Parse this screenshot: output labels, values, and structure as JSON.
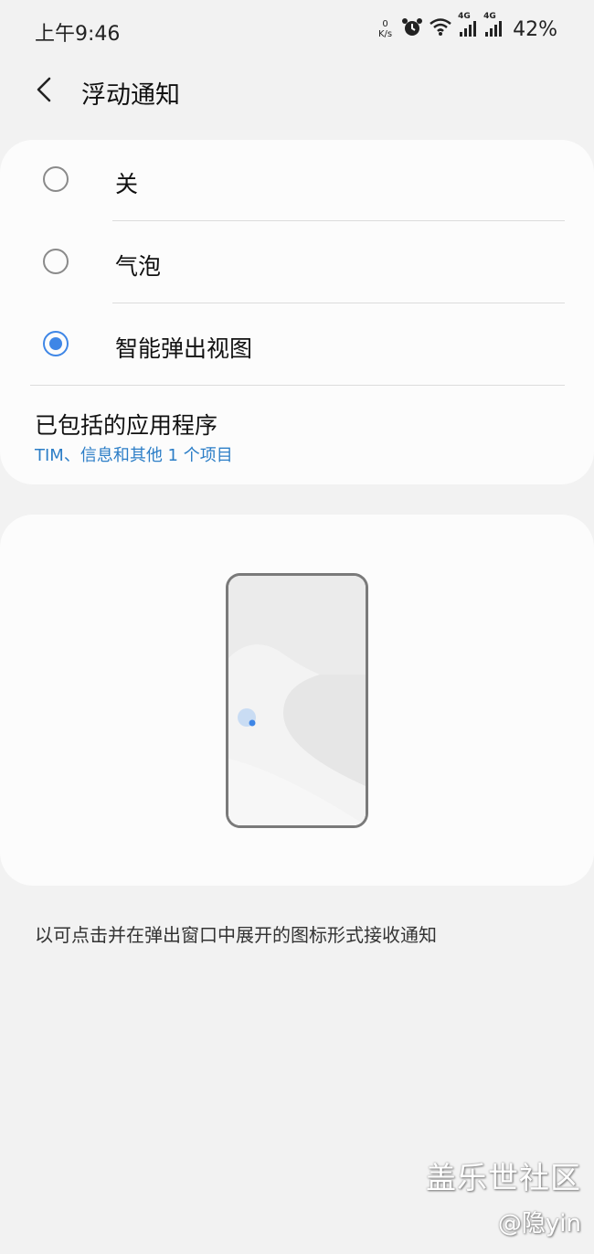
{
  "status_bar": {
    "time": "上午9:46",
    "net_speed_value": "0",
    "net_speed_unit": "K/s",
    "signal_label_1": "4G",
    "signal_label_2": "4G",
    "battery": "42%"
  },
  "header": {
    "title": "浮动通知",
    "back_icon": "chevron-left-icon"
  },
  "options": [
    {
      "label": "关",
      "selected": false
    },
    {
      "label": "气泡",
      "selected": false
    },
    {
      "label": "智能弹出视图",
      "selected": true
    }
  ],
  "included_apps": {
    "title": "已包括的应用程序",
    "subtitle": "TIM、信息和其他 1 个项目"
  },
  "description": "以可点击并在弹出窗口中展开的图标形式接收通知",
  "watermark": {
    "logo": "盖乐世社区",
    "user": "@隐yin"
  },
  "colors": {
    "accent": "#3e86e6",
    "link": "#2c7ec7",
    "background": "#f2f2f2",
    "card": "#fcfcfc"
  }
}
